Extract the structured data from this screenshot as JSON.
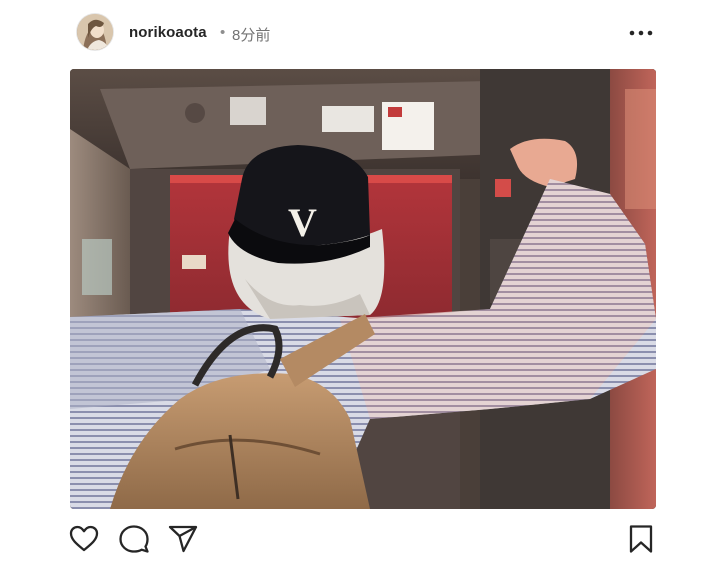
{
  "post": {
    "username": "norikoaota",
    "separator": "•",
    "timestamp": "8分前"
  },
  "header": {
    "more_icon": "more-horizontal-icon"
  },
  "photo": {
    "subject": "person with V cap and backpack in elevator",
    "cap_letter": "V"
  },
  "actions": {
    "like_icon": "heart-icon",
    "comment_icon": "comment-bubble-icon",
    "share_icon": "paper-plane-icon",
    "save_icon": "bookmark-icon"
  },
  "colors": {
    "text_primary": "#262626",
    "text_secondary": "#737373",
    "icon": "#262626"
  }
}
